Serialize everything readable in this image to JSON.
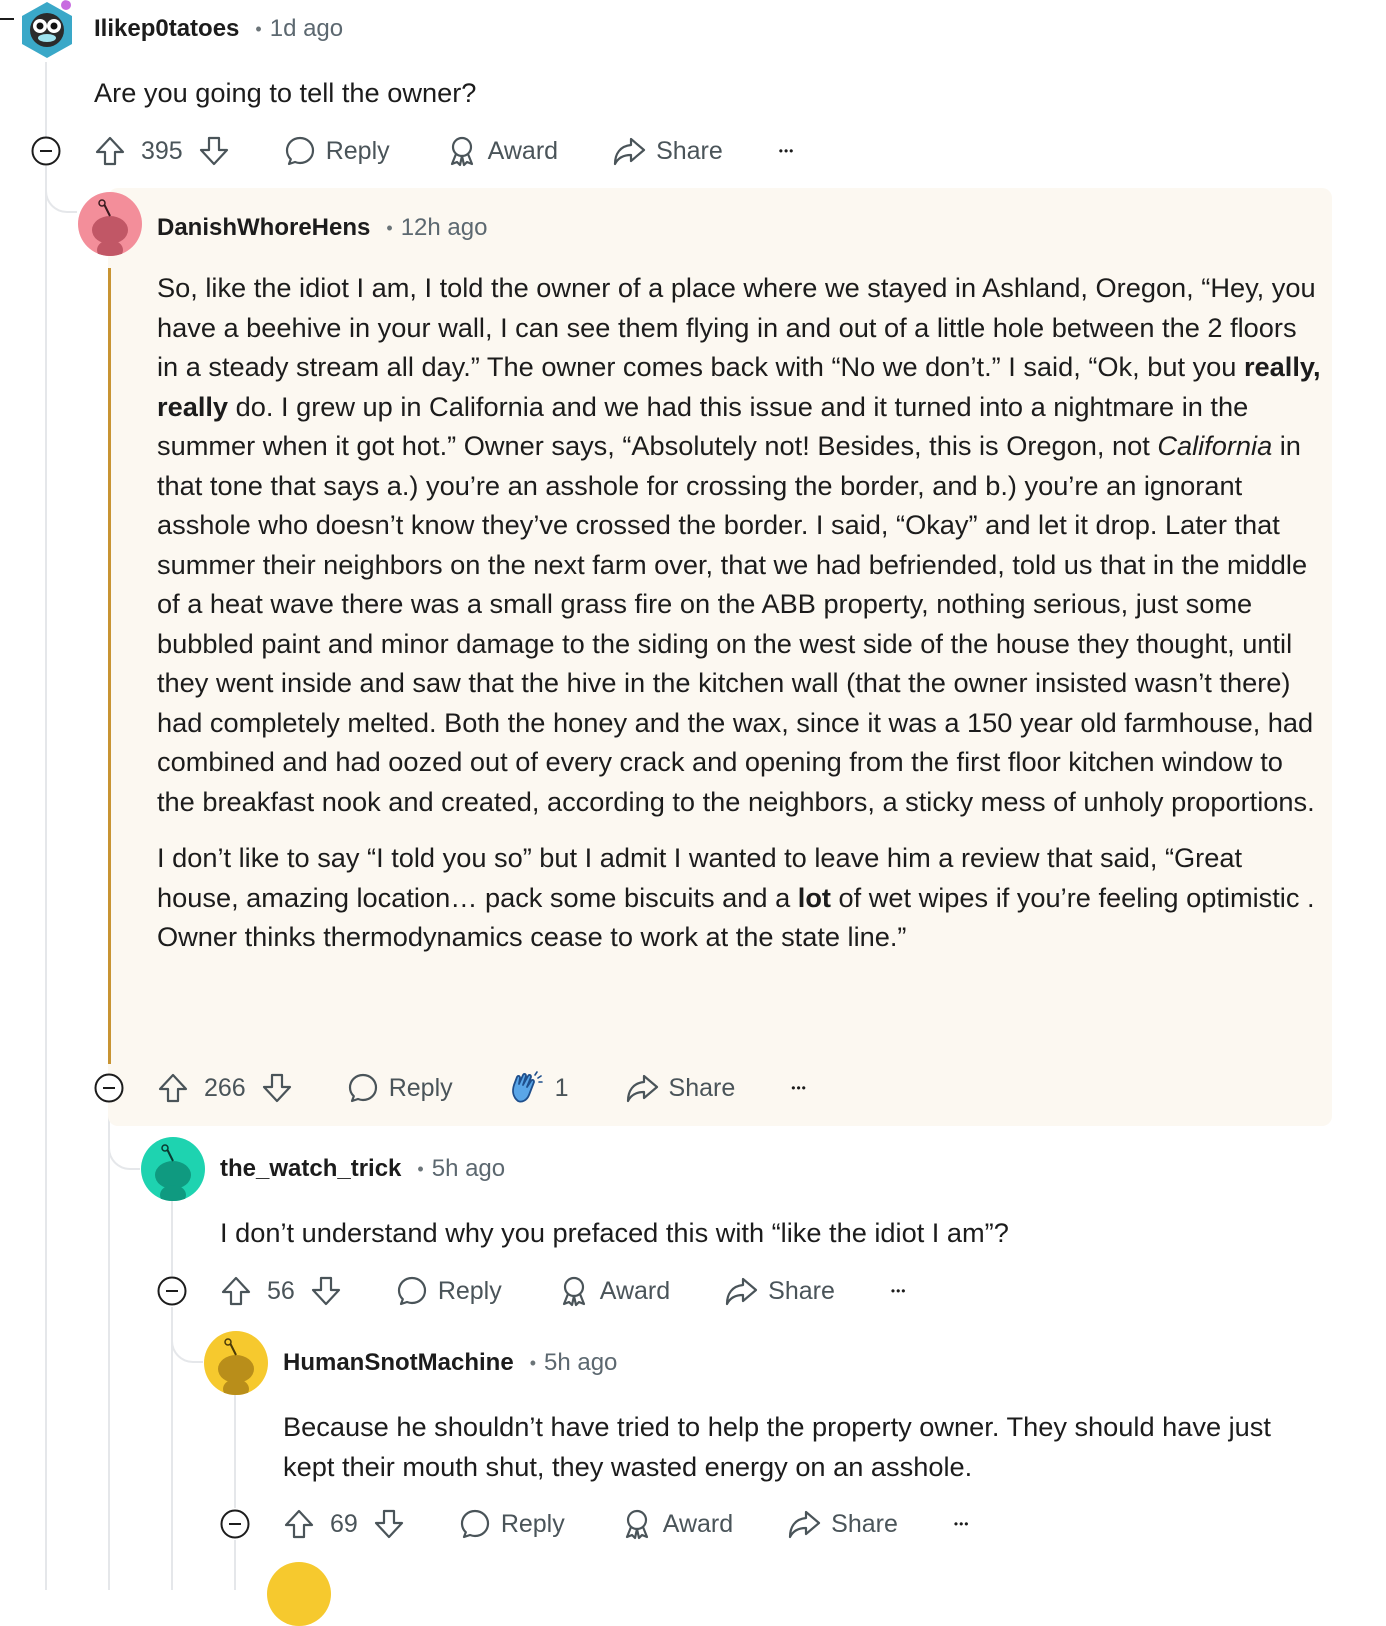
{
  "comments": [
    {
      "username": "Ilikep0tatoes",
      "time": "1d ago",
      "body": [
        "Are you going to tell the owner?"
      ],
      "votes": "395",
      "reply_label": "Reply",
      "award_label": "Award",
      "share_label": "Share",
      "more_label": "•••"
    },
    {
      "username": "DanishWhoreHens",
      "time": "12h ago",
      "body_p1_a": "So, like the idiot I am, I told the owner of a place where we stayed in Ashland, Oregon, “Hey, you have a beehive in your wall, I can see them flying in and out of a little hole between the 2 floors in a steady stream all day.” The owner comes back with “No we don’t.” I said, “Ok, but you ",
      "body_p1_bold": "really, really",
      "body_p1_b": " do. I grew up in California and we had this issue and it turned into a nightmare in the summer when it got hot.” Owner says, “Absolutely not! Besides, this is Oregon, not ",
      "body_p1_italic": "California",
      "body_p1_c": " in that tone that says a.) you’re an asshole for crossing the border, and b.) you’re an ignorant asshole who doesn’t know they’ve crossed the border. I said, “Okay” and let it drop. Later that summer their neighbors on the next farm over, that we had befriended, told us that in the middle of a heat wave there was a small grass fire on the ABB property, nothing serious, just some bubbled paint and minor damage to the siding on the west side of the house they thought, until they went inside and saw that the hive in the kitchen wall (that the owner insisted wasn’t there) had completely melted. Both the honey and the wax, since it was a 150 year old farmhouse, had combined and had oozed out of every crack and opening from the first floor kitchen window to the breakfast nook and created, according to the neighbors, a sticky mess of unholy proportions.",
      "body_p2_a": "I don’t like to say “I told you so” but I admit I wanted to leave him a review that said, “Great house, amazing location… pack some biscuits and a ",
      "body_p2_bold": "lot",
      "body_p2_b": " of wet wipes if you’re feeling optimistic . Owner thinks thermodynamics cease to work at the state line.”",
      "votes": "266",
      "reply_label": "Reply",
      "award_count": "1",
      "share_label": "Share",
      "more_label": "•••"
    },
    {
      "username": "the_watch_trick",
      "time": "5h ago",
      "body": [
        "I don’t understand why you prefaced this with “like the idiot I am”?"
      ],
      "votes": "56",
      "reply_label": "Reply",
      "award_label": "Award",
      "share_label": "Share",
      "more_label": "•••"
    },
    {
      "username": "HumanSnotMachine",
      "time": "5h ago",
      "body": [
        "Because he shouldn’t have tried to help the property owner. They should have just kept their mouth shut, they wasted energy on an asshole."
      ],
      "votes": "69",
      "reply_label": "Reply",
      "award_label": "Award",
      "share_label": "Share",
      "more_label": "•••"
    }
  ],
  "colors": {
    "highlight_bg": "#fcf8f1",
    "op_line": "#c89433",
    "thread_line": "#e5e7ea",
    "avatar_pink": "#f38e9a",
    "avatar_teal": "#1ed3b0",
    "avatar_yellow": "#f6c92e"
  },
  "icons": [
    "upvote-icon",
    "downvote-icon",
    "reply-bubble-icon",
    "award-icon",
    "share-icon",
    "more-icon",
    "collapse-icon",
    "clapping-hands-icon"
  ]
}
